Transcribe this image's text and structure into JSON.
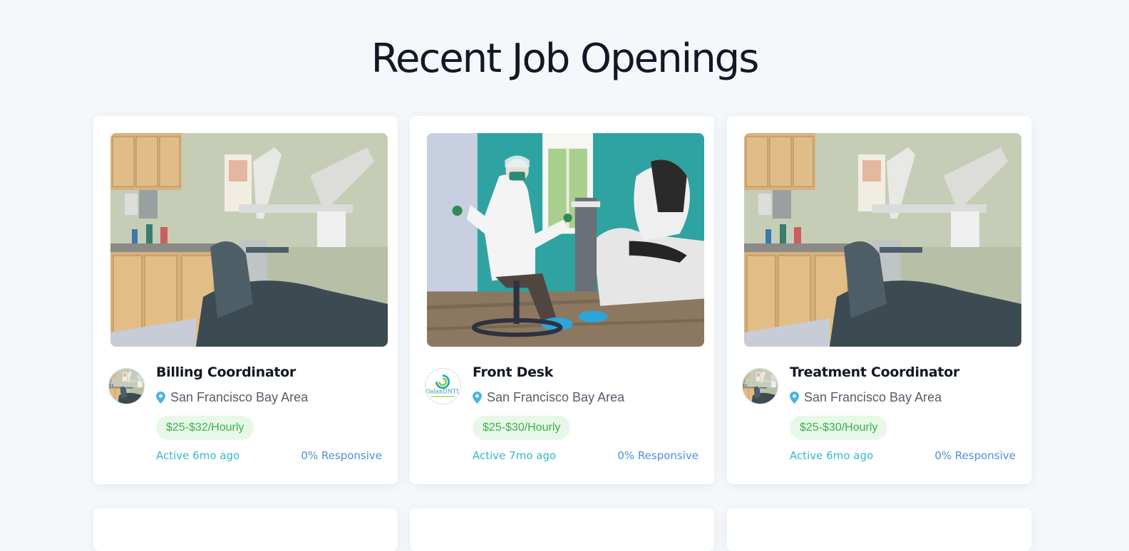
{
  "page": {
    "title": "Recent Job Openings"
  },
  "colors": {
    "background": "#f5f8fb",
    "title": "#121826",
    "pin": "#4ab3e8",
    "pay_bg": "#e8f8e8",
    "pay_text": "#3caf4a",
    "active_text": "#37b7c8",
    "responsive_text": "#4a90d9"
  },
  "jobs": [
    {
      "image": "dental-office-photo",
      "avatar": "dental-office-avatar",
      "title": "Billing Coordinator",
      "location_icon": "map-pin-icon",
      "location": "San Francisco Bay Area",
      "pay": "$25-$32/Hourly",
      "active": "Active 6mo ago",
      "responsive": "0% Responsive"
    },
    {
      "image": "dentist-in-ppe-photo",
      "avatar": "galan-dntl-logo",
      "avatar_text": "GalanDNTL",
      "title": "Front Desk",
      "location_icon": "map-pin-icon",
      "location": "San Francisco Bay Area",
      "pay": "$25-$30/Hourly",
      "active": "Active 7mo ago",
      "responsive": "0% Responsive"
    },
    {
      "image": "dental-office-photo",
      "avatar": "dental-office-avatar",
      "title": "Treatment Coordinator",
      "location_icon": "map-pin-icon",
      "location": "San Francisco Bay Area",
      "pay": "$25-$30/Hourly",
      "active": "Active 6mo ago",
      "responsive": "0% Responsive"
    }
  ]
}
